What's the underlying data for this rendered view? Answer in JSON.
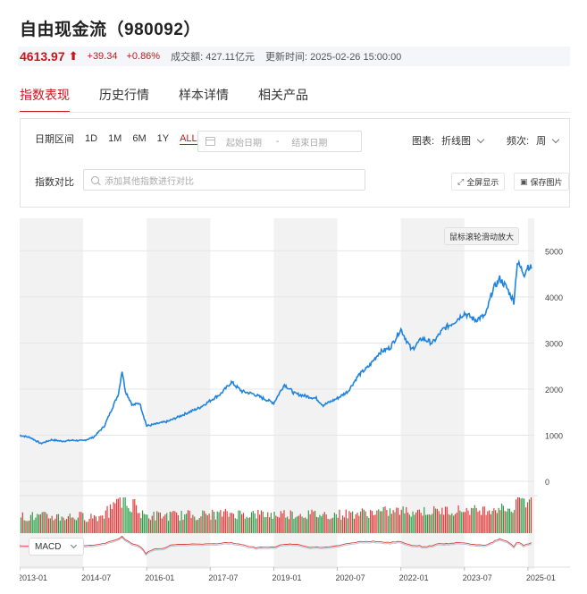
{
  "header": {
    "title": "自由现金流（980092）"
  },
  "quote": {
    "price": "4613.97",
    "change": "+39.34",
    "change_pct": "+0.86%",
    "volume_label": "成交额: 427.11亿元",
    "update_label": "更新时间: 2025-02-26 15:00:00",
    "up_color": "#c8161d"
  },
  "tabs": [
    {
      "label": "指数表现",
      "active": true
    },
    {
      "label": "历史行情",
      "active": false
    },
    {
      "label": "样本详情",
      "active": false
    },
    {
      "label": "相关产品",
      "active": false
    }
  ],
  "filters": {
    "range_label": "日期区间",
    "ranges": [
      "1D",
      "1M",
      "6M",
      "1Y",
      "ALL"
    ],
    "active_range": "ALL",
    "start_placeholder": "起始日期",
    "separator": "-",
    "end_placeholder": "结束日期",
    "chart_type_label": "图表:",
    "chart_type_value": "折线图",
    "freq_label": "频次:",
    "freq_value": "周",
    "compare_label": "指数对比",
    "compare_placeholder": "添加其他指数进行对比",
    "fullscreen_label": "全屏显示",
    "save_label": "保存图片"
  },
  "chart_hint": "鼠标滚轮滑动放大",
  "indicator_select": "MACD",
  "chart_data": {
    "type": "line",
    "line_color": "#1f84e0",
    "y_ticks": [
      "5000",
      "4000",
      "3000",
      "2000",
      "1000",
      "0"
    ],
    "ylim": [
      0,
      5000
    ],
    "x_ticks": [
      "2013-01",
      "2014-07",
      "2016-01",
      "2017-07",
      "2019-01",
      "2020-07",
      "2022-01",
      "2023-07",
      "2025-01"
    ],
    "series": [
      {
        "points": [
          [
            "2013-01",
            1000
          ],
          [
            "2013-04",
            950
          ],
          [
            "2013-07",
            820
          ],
          [
            "2013-10",
            900
          ],
          [
            "2014-01",
            870
          ],
          [
            "2014-04",
            890
          ],
          [
            "2014-07",
            880
          ],
          [
            "2014-10",
            960
          ],
          [
            "2015-01",
            1200
          ],
          [
            "2015-03",
            1550
          ],
          [
            "2015-05",
            1900
          ],
          [
            "2015-06",
            2400
          ],
          [
            "2015-07",
            1950
          ],
          [
            "2015-09",
            1650
          ],
          [
            "2015-11",
            1700
          ],
          [
            "2016-01",
            1200
          ],
          [
            "2016-04",
            1250
          ],
          [
            "2016-07",
            1300
          ],
          [
            "2016-10",
            1400
          ],
          [
            "2017-01",
            1500
          ],
          [
            "2017-04",
            1600
          ],
          [
            "2017-07",
            1750
          ],
          [
            "2017-10",
            1900
          ],
          [
            "2018-01",
            2150
          ],
          [
            "2018-04",
            1950
          ],
          [
            "2018-07",
            1900
          ],
          [
            "2018-10",
            1800
          ],
          [
            "2019-01",
            1700
          ],
          [
            "2019-04",
            2100
          ],
          [
            "2019-07",
            1900
          ],
          [
            "2019-10",
            1850
          ],
          [
            "2020-01",
            1800
          ],
          [
            "2020-03",
            1650
          ],
          [
            "2020-07",
            1800
          ],
          [
            "2020-10",
            1950
          ],
          [
            "2021-01",
            2300
          ],
          [
            "2021-04",
            2500
          ],
          [
            "2021-07",
            2800
          ],
          [
            "2021-10",
            2900
          ],
          [
            "2022-01",
            3300
          ],
          [
            "2022-04",
            2850
          ],
          [
            "2022-07",
            3100
          ],
          [
            "2022-10",
            3000
          ],
          [
            "2023-01",
            3300
          ],
          [
            "2023-04",
            3450
          ],
          [
            "2023-07",
            3650
          ],
          [
            "2023-10",
            3500
          ],
          [
            "2024-01",
            3600
          ],
          [
            "2024-03",
            4150
          ],
          [
            "2024-05",
            4400
          ],
          [
            "2024-07",
            4200
          ],
          [
            "2024-09",
            3900
          ],
          [
            "2024-10",
            4750
          ],
          [
            "2024-12",
            4500
          ],
          [
            "2025-01",
            4680
          ],
          [
            "2025-02",
            4614
          ]
        ]
      }
    ]
  }
}
